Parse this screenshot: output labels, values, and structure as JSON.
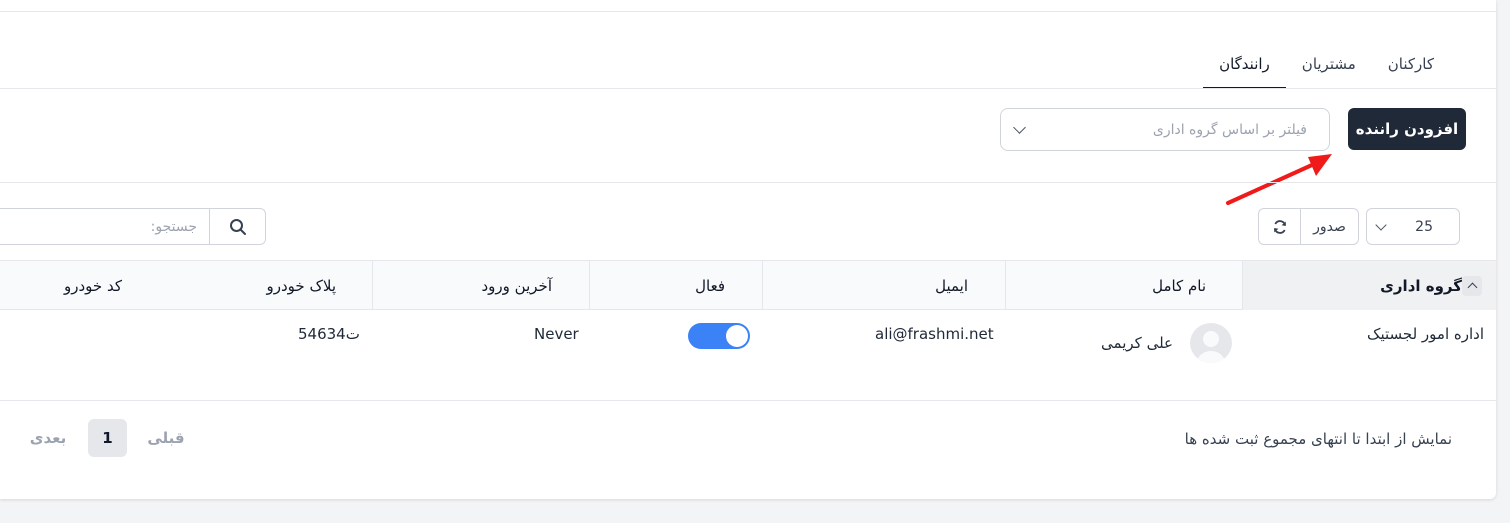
{
  "tabs": [
    {
      "label": "کارکنان",
      "active": false
    },
    {
      "label": "مشتریان",
      "active": false
    },
    {
      "label": "رانندگان",
      "active": true
    }
  ],
  "toolbar": {
    "add_label": "افزودن راننده",
    "filter_placeholder": "فیلتر بر اساس گروه اداری"
  },
  "table_controls": {
    "page_size": "25",
    "export_label": "صدور",
    "search_placeholder": "جستجو:"
  },
  "table": {
    "headers": {
      "group": "گروه اداری",
      "name": "نام کامل",
      "email": "ایمیل",
      "active": "فعال",
      "last_login": "آخرین ورود",
      "plate": "پلاک خودرو",
      "vehicle_code": "کد خودرو"
    },
    "rows": [
      {
        "group": "اداره امور لجستیک",
        "name": "علی کریمی",
        "email": "ali@frashmi.net",
        "active": true,
        "last_login": "Never",
        "plate": "546ت34",
        "vehicle_code": ""
      }
    ]
  },
  "footer": {
    "info": "نمایش از ابتدا تا انتهای مجموع ثبت شده ها",
    "prev_label": "قبلی",
    "current_page": "1",
    "next_label": "بعدی"
  },
  "colors": {
    "primary_button": "#1f2937",
    "toggle_on": "#3b82f6",
    "annotation_arrow": "#ef1a1a"
  },
  "icons": [
    "chevron-down-icon",
    "refresh-icon",
    "search-icon",
    "sort-up-icon",
    "avatar-icon",
    "red-arrow-annotation"
  ]
}
